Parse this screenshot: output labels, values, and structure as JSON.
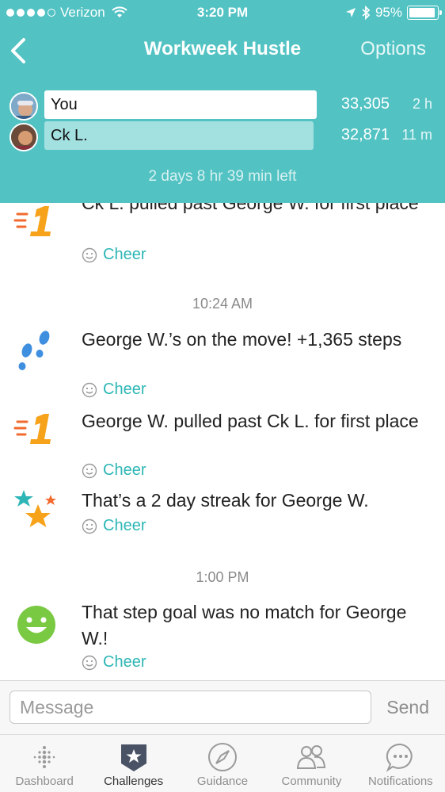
{
  "status_bar": {
    "carrier": "Verizon",
    "time": "3:20 PM",
    "battery": "95%",
    "battery_level": 0.95
  },
  "nav": {
    "title": "Workweek Hustle",
    "options_label": "Options",
    "back_icon": "chevron-left-icon"
  },
  "leaderboard": [
    {
      "name": "You",
      "steps": "33,305",
      "time": "2 h",
      "bar_fraction": 1.0
    },
    {
      "name": "Ck L.",
      "steps": "32,871",
      "time": "11 m",
      "bar_fraction": 0.987
    }
  ],
  "time_left": "2 days 8 hr 39 min left",
  "feed": {
    "cheer_label": "Cheer",
    "items": [
      {
        "icon": "first-place-icon",
        "text": "Ck L. pulled past George W. for first place"
      },
      {
        "timestamp": "10:24 AM"
      },
      {
        "icon": "footsteps-icon",
        "text": "George W.’s on the move! +1,365 steps"
      },
      {
        "icon": "first-place-icon",
        "text": "George W. pulled past Ck L. for first place"
      },
      {
        "icon": "stars-icon",
        "text": "That’s a 2 day streak for George W."
      },
      {
        "timestamp": "1:00 PM"
      },
      {
        "icon": "smiley-icon",
        "text": "That step goal was no match for George W.!"
      }
    ]
  },
  "message": {
    "placeholder": "Message",
    "value": "",
    "send_label": "Send"
  },
  "tabs": [
    {
      "label": "Dashboard",
      "icon": "dashboard-icon",
      "active": false
    },
    {
      "label": "Challenges",
      "icon": "challenges-star-icon",
      "active": true
    },
    {
      "label": "Guidance",
      "icon": "compass-icon",
      "active": false
    },
    {
      "label": "Community",
      "icon": "people-icon",
      "active": false
    },
    {
      "label": "Notifications",
      "icon": "chat-bubble-icon",
      "active": false
    }
  ],
  "colors": {
    "header": "#52c2c3",
    "accent": "#2eb6b6",
    "first_place": "#f7a21b",
    "footsteps": "#3f8fe0",
    "smiley": "#7ac943"
  }
}
